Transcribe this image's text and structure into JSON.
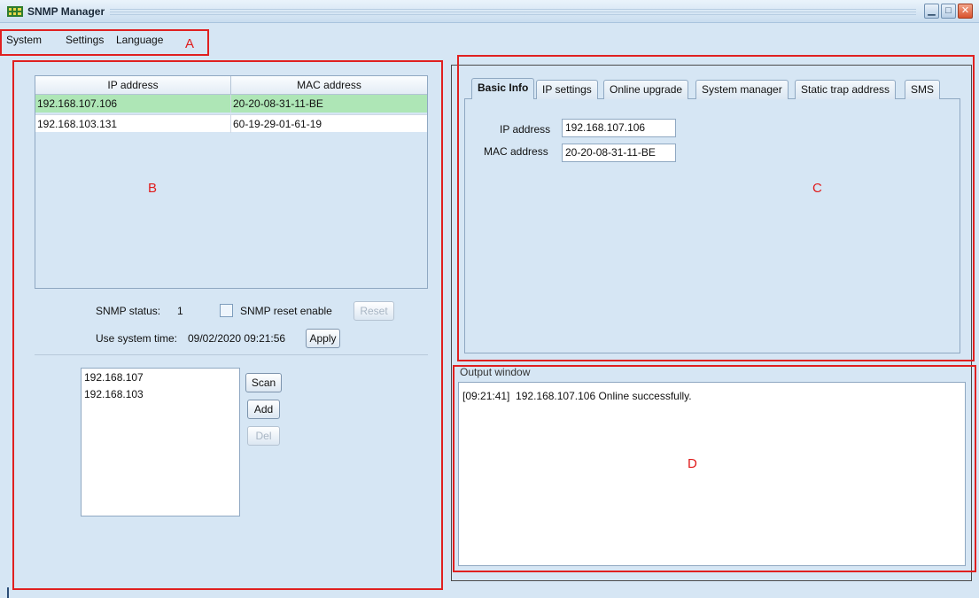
{
  "window": {
    "title": "SNMP Manager",
    "minimize_icon": "minimize-icon",
    "maximize_icon": "maximize-icon",
    "close_icon": "close-icon"
  },
  "menu": [
    "System",
    "Settings",
    "Language"
  ],
  "annotations": {
    "a": "A",
    "b": "B",
    "c": "C",
    "d": "D",
    "box_color": "#e02020"
  },
  "device_table": {
    "headers": [
      "IP address",
      "MAC address"
    ],
    "rows": [
      [
        "192.168.107.106",
        "20-20-08-31-11-BE"
      ],
      [
        "192.168.103.131",
        "60-19-29-01-61-19"
      ]
    ],
    "selected_row_color": "#aee6b6"
  },
  "snmp": {
    "status_label": "SNMP status:",
    "status_value": "1",
    "reset_enable_label": "SNMP reset enable",
    "reset_button": "Reset",
    "system_time_label": "Use system time:",
    "system_time_value": "09/02/2020 09:21:56",
    "apply_button": "Apply"
  },
  "subnets": {
    "items": [
      "192.168.107",
      "192.168.103"
    ],
    "scan_button": "Scan",
    "add_button": "Add",
    "del_button": "Del"
  },
  "tabs": [
    "Basic Info",
    "IP settings",
    "Online upgrade",
    "System manager",
    "Static trap address",
    "SMS"
  ],
  "basic_info": {
    "ip_label": "IP address",
    "ip_value": "192.168.107.106",
    "mac_label": "MAC address",
    "mac_value": "20-20-08-31-11-BE"
  },
  "output": {
    "legend": "Output window",
    "lines": [
      "[09:21:41]  192.168.107.106 Online successfully."
    ]
  }
}
